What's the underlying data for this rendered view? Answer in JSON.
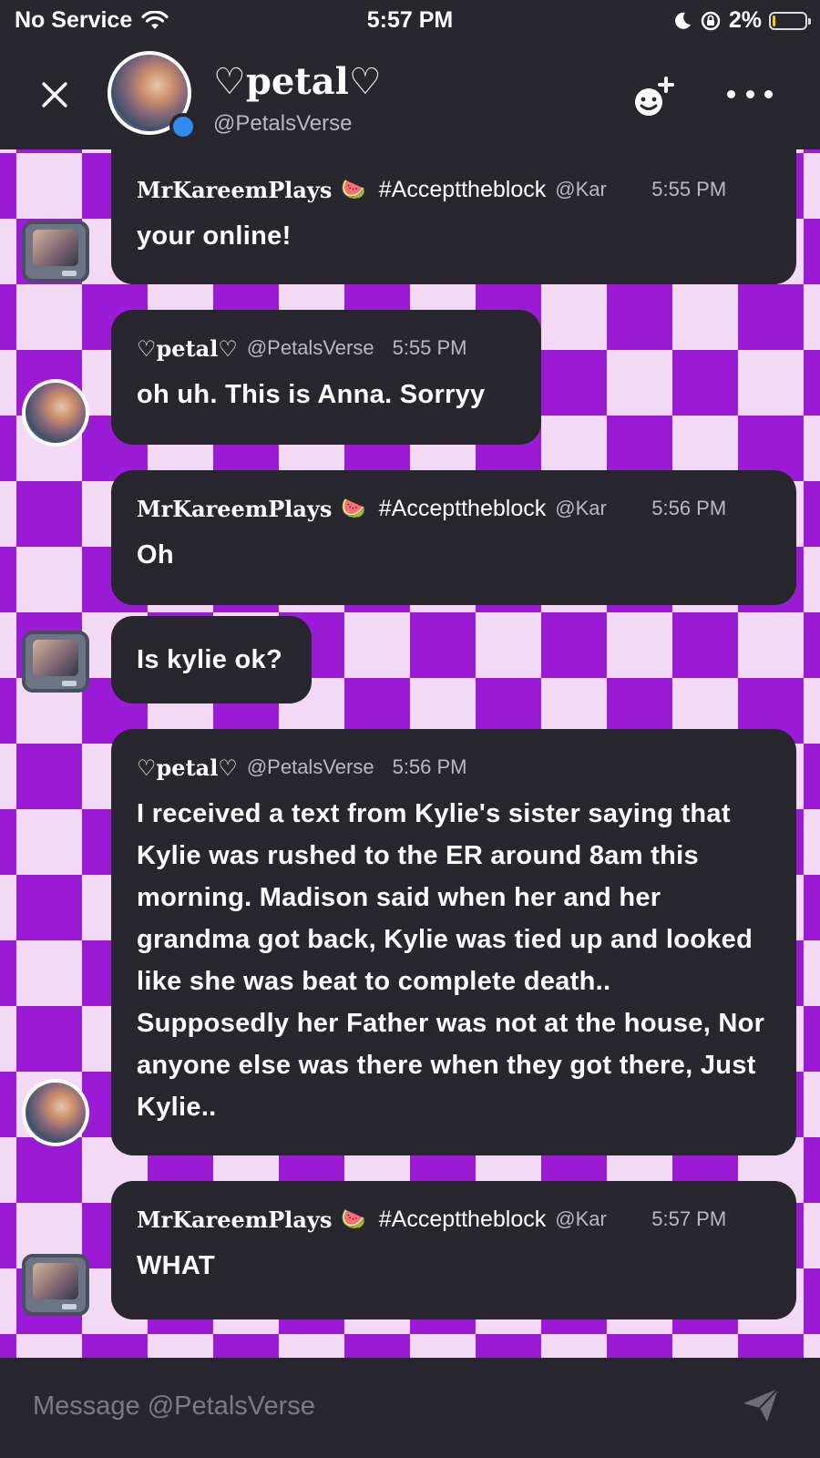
{
  "status_bar": {
    "carrier": "No Service",
    "time": "5:57 PM",
    "battery": "2%",
    "battery_level": 0.02
  },
  "header": {
    "title": "♡petal♡",
    "handle": "@PetalsVerse"
  },
  "messages": [
    {
      "sender": "MrKareemPlays",
      "tag": "#Accepttheblock",
      "handle": "@Kar",
      "time": "5:55 PM",
      "text": "your online!"
    },
    {
      "sender": "♡petal♡",
      "handle": "@PetalsVerse",
      "time": "5:55 PM",
      "text": "oh uh. This is Anna. Sorryy"
    },
    {
      "sender": "MrKareemPlays",
      "tag": "#Accepttheblock",
      "handle": "@Kar",
      "time": "5:56 PM",
      "text": "Oh"
    },
    {
      "text": "Is kylie ok?"
    },
    {
      "sender": "♡petal♡",
      "handle": "@PetalsVerse",
      "time": "5:56 PM",
      "text": "I received a text from Kylie's sister saying that Kylie was rushed to the ER around 8am this morning. Madison said when her and her grandma got back, Kylie was tied up and looked like she was beat to complete death.. Supposedly her Father was not at the house, Nor anyone else was there when they got there, Just Kylie.."
    },
    {
      "sender": "MrKareemPlays",
      "tag": "#Accepttheblock",
      "handle": "@Kar",
      "time": "5:57 PM",
      "text": "WHAT"
    }
  ],
  "composer": {
    "placeholder": "Message @PetalsVerse"
  },
  "colors": {
    "background": "#28272d",
    "checker_purple": "#9a1ad6",
    "checker_light": "#f2d9f6",
    "online": "#2e8cf0"
  }
}
